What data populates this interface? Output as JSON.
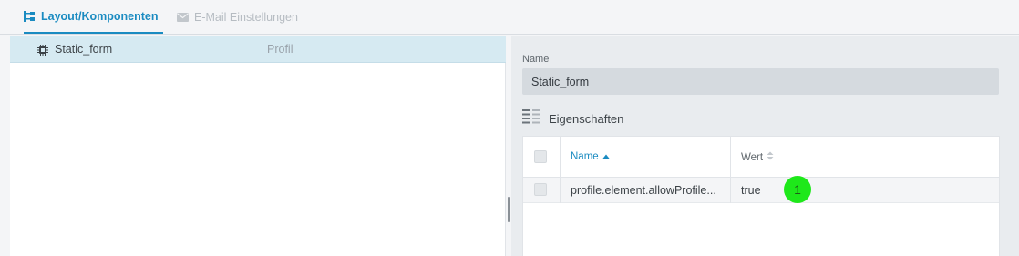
{
  "tabs": [
    {
      "label": "Layout/Komponenten",
      "icon": "tree-structure-icon",
      "active": true
    },
    {
      "label": "E-Mail Einstellungen",
      "icon": "envelope-icon",
      "active": false
    }
  ],
  "tree": {
    "rows": [
      {
        "name": "Static_form",
        "type": "Profil",
        "icon": "chip-icon",
        "selected": true
      }
    ]
  },
  "details": {
    "name_label": "Name",
    "name_value": "Static_form",
    "properties_title": "Eigenschaften",
    "table": {
      "columns": [
        {
          "label": "Name",
          "sort": "ascending"
        },
        {
          "label": "Wert",
          "sort": "none"
        }
      ],
      "rows": [
        {
          "name": "profile.element.allowProfile...",
          "value": "true"
        }
      ]
    }
  },
  "marker": {
    "label": "1",
    "color": "#1ee81a"
  },
  "colors": {
    "accent": "#1a8bc1",
    "selected_row": "#d6eaf2",
    "input_bg": "#d5dadf"
  }
}
